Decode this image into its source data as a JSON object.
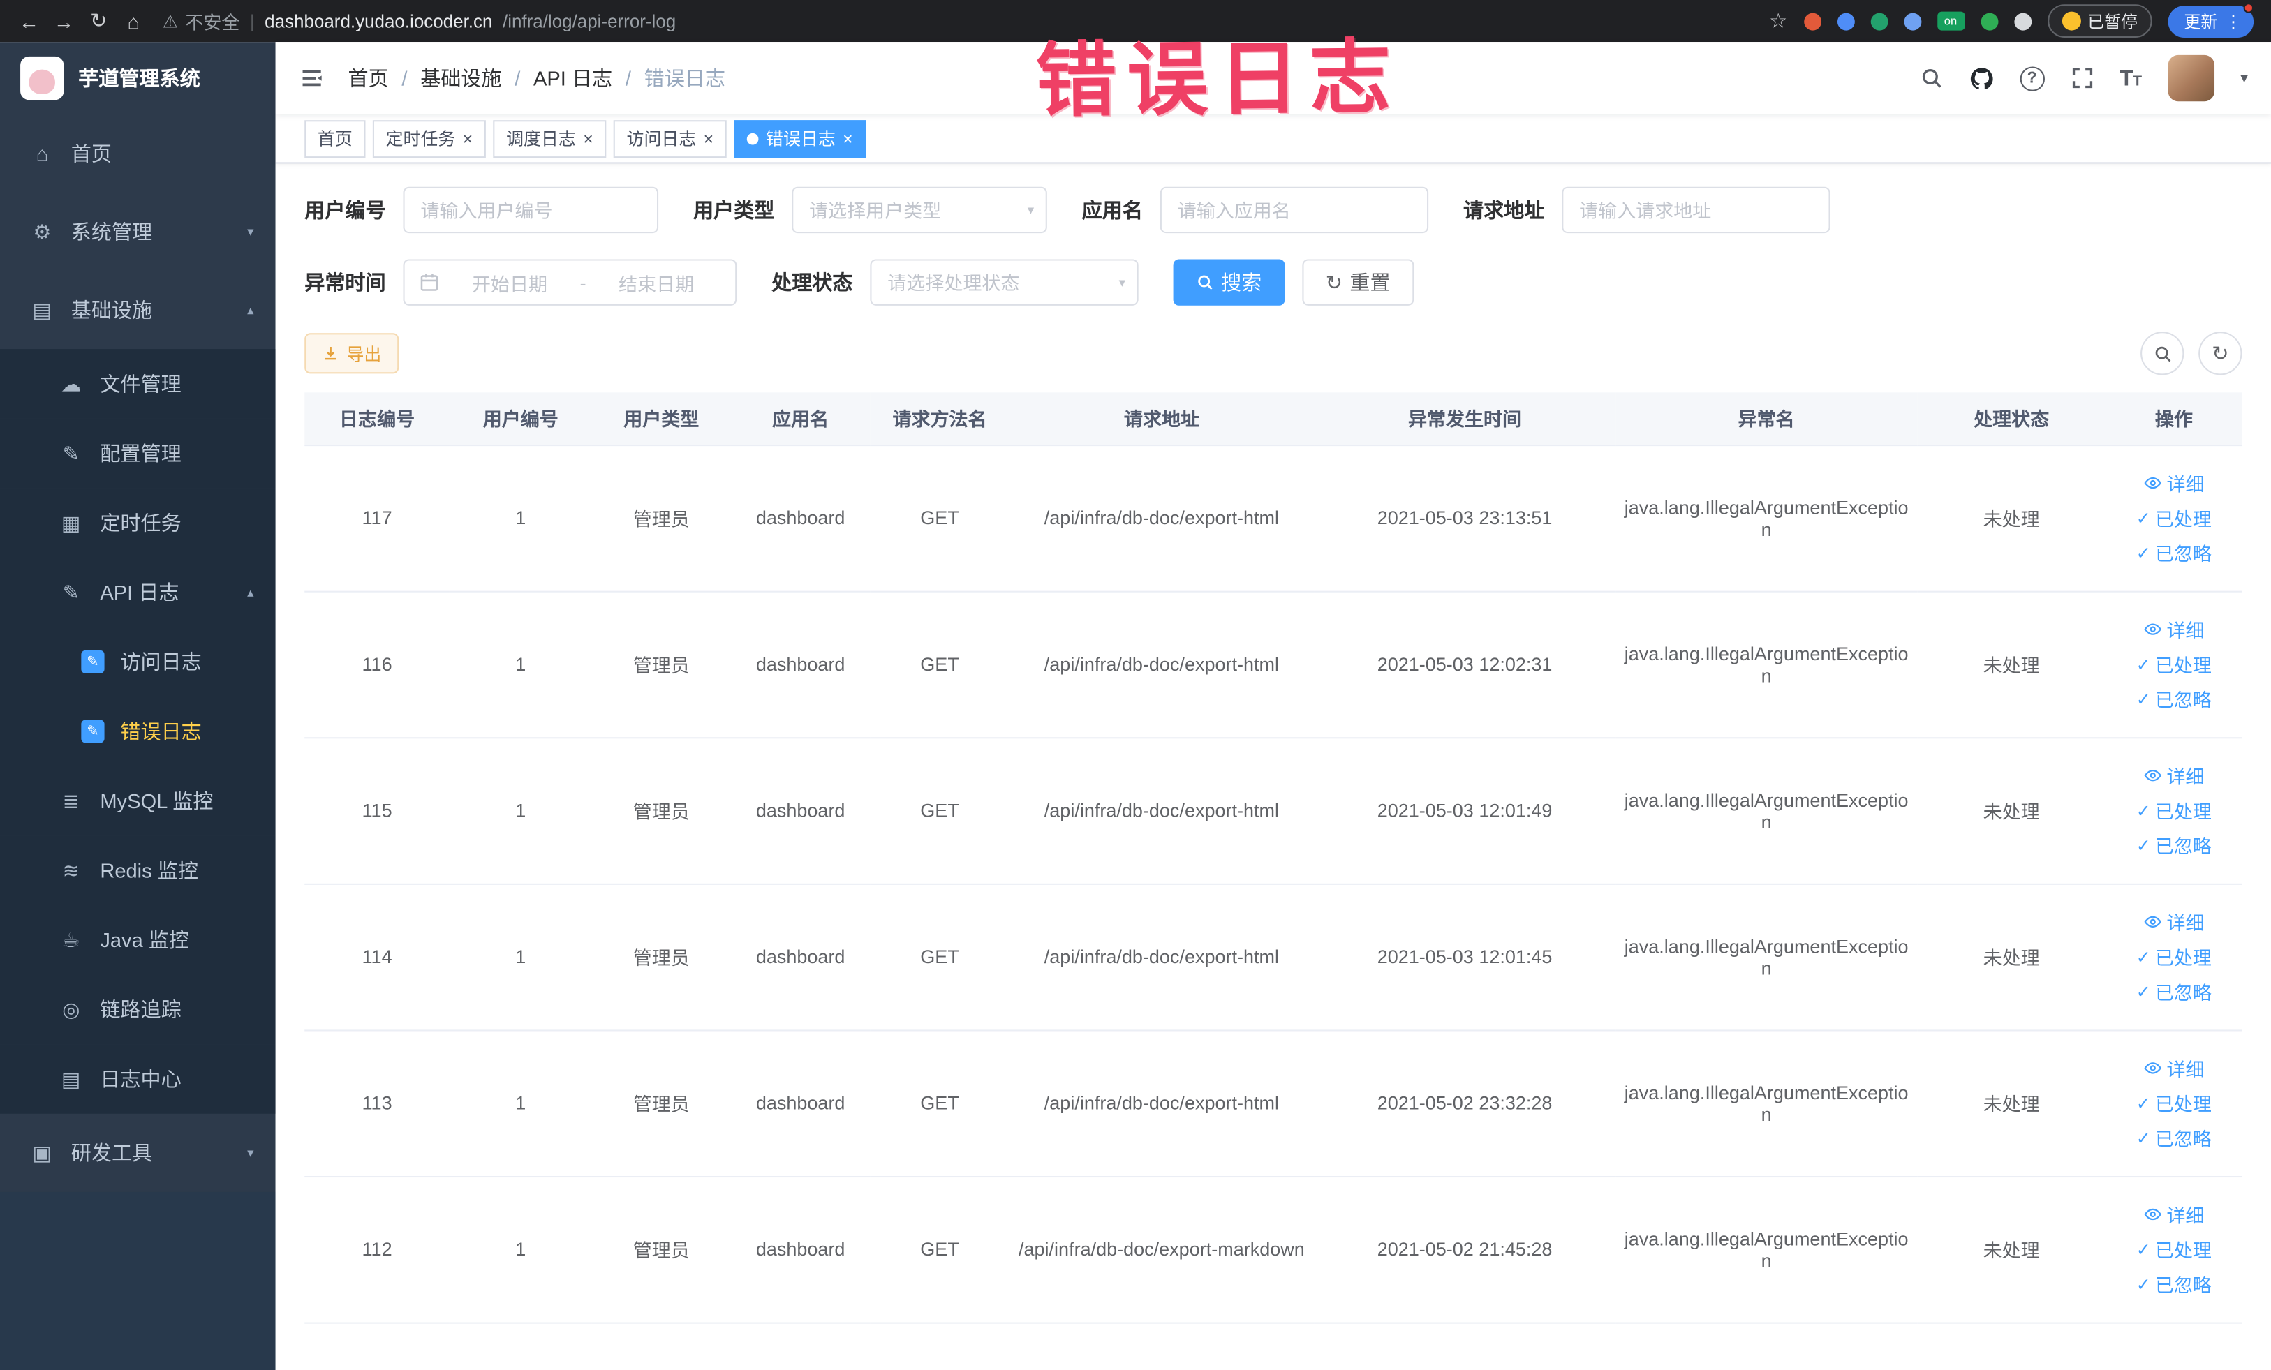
{
  "colors": {
    "accent": "#409eff",
    "active_menu_text": "#ffd04b",
    "warning": "#e6a23c",
    "annotation": "#ef4065",
    "sidebar_bg": "#2d3a4b",
    "submenu_bg": "#1f2d3d"
  },
  "icons": {
    "back": "←",
    "forward": "→",
    "reload": "↻",
    "home": "⌂",
    "warning": "⚠",
    "pipe": "|",
    "star": "☆",
    "kebab": "⋮",
    "caret_down": "▾",
    "caret_up": "▴",
    "close": "×",
    "check": "✓",
    "refresh": "↻",
    "help": "?",
    "font_large": "T",
    "font_small": "T",
    "menu_home": "⌂",
    "menu_system": "⚙",
    "menu_infra": "▤",
    "menu_file": "☁",
    "menu_config": "✎",
    "menu_job": "▦",
    "menu_api": "✎",
    "menu_edit": "✎",
    "menu_mysql": "≣",
    "menu_redis": "≋",
    "menu_java": "☕",
    "menu_trace": "◎",
    "menu_log": "▤",
    "menu_dev": "▣"
  },
  "annotation": {
    "text": "错误日志"
  },
  "browser": {
    "security_label": "不安全",
    "url_domain": "dashboard.yudao.iocoder.cn",
    "url_path": "/infra/log/api-error-log",
    "ext_on_label": "on",
    "paused_label": "已暂停",
    "update_label": "更新"
  },
  "sidebar": {
    "logo_title": "芋道管理系统",
    "items": {
      "home": "首页",
      "system": "系统管理",
      "infra": "基础设施",
      "file": "文件管理",
      "config": "配置管理",
      "job": "定时任务",
      "api_log": "API 日志",
      "access_log": "访问日志",
      "error_log": "错误日志",
      "mysql": "MySQL 监控",
      "redis": "Redis 监控",
      "java": "Java 监控",
      "trace": "链路追踪",
      "log_center": "日志中心",
      "dev_tools": "研发工具"
    }
  },
  "header": {
    "breadcrumb": [
      "首页",
      "基础设施",
      "API 日志",
      "错误日志"
    ],
    "separator": "/"
  },
  "tabs": [
    {
      "label": "首页"
    },
    {
      "label": "定时任务"
    },
    {
      "label": "调度日志"
    },
    {
      "label": "访问日志"
    },
    {
      "label": "错误日志"
    }
  ],
  "filters": {
    "user_id": {
      "label": "用户编号",
      "placeholder": "请输入用户编号"
    },
    "user_type": {
      "label": "用户类型",
      "placeholder": "请选择用户类型"
    },
    "app_name": {
      "label": "应用名",
      "placeholder": "请输入应用名"
    },
    "request_url": {
      "label": "请求地址",
      "placeholder": "请输入请求地址"
    },
    "exception_time": {
      "label": "异常时间",
      "start_placeholder": "开始日期",
      "separator": "-",
      "end_placeholder": "结束日期"
    },
    "process_status": {
      "label": "处理状态",
      "placeholder": "请选择处理状态"
    },
    "search_label": "搜索",
    "reset_label": "重置"
  },
  "toolbar": {
    "export_label": "导出"
  },
  "table": {
    "headers": [
      "日志编号",
      "用户编号",
      "用户类型",
      "应用名",
      "请求方法名",
      "请求地址",
      "异常发生时间",
      "异常名",
      "处理状态",
      "操作"
    ],
    "actions": [
      "详细",
      "已处理",
      "已忽略"
    ],
    "rows": [
      {
        "id": "117",
        "user_id": "1",
        "user_type": "管理员",
        "app": "dashboard",
        "method": "GET",
        "url": "/api/infra/db-doc/export-html",
        "time": "2021-05-03 23:13:51",
        "exception": "java.lang.IllegalArgumentException",
        "status": "未处理"
      },
      {
        "id": "116",
        "user_id": "1",
        "user_type": "管理员",
        "app": "dashboard",
        "method": "GET",
        "url": "/api/infra/db-doc/export-html",
        "time": "2021-05-03 12:02:31",
        "exception": "java.lang.IllegalArgumentException",
        "status": "未处理"
      },
      {
        "id": "115",
        "user_id": "1",
        "user_type": "管理员",
        "app": "dashboard",
        "method": "GET",
        "url": "/api/infra/db-doc/export-html",
        "time": "2021-05-03 12:01:49",
        "exception": "java.lang.IllegalArgumentException",
        "status": "未处理"
      },
      {
        "id": "114",
        "user_id": "1",
        "user_type": "管理员",
        "app": "dashboard",
        "method": "GET",
        "url": "/api/infra/db-doc/export-html",
        "time": "2021-05-03 12:01:45",
        "exception": "java.lang.IllegalArgumentException",
        "status": "未处理"
      },
      {
        "id": "113",
        "user_id": "1",
        "user_type": "管理员",
        "app": "dashboard",
        "method": "GET",
        "url": "/api/infra/db-doc/export-html",
        "time": "2021-05-02 23:32:28",
        "exception": "java.lang.IllegalArgumentException",
        "status": "未处理"
      },
      {
        "id": "112",
        "user_id": "1",
        "user_type": "管理员",
        "app": "dashboard",
        "method": "GET",
        "url": "/api/infra/db-doc/export-markdown",
        "time": "2021-05-02 21:45:28",
        "exception": "java.lang.IllegalArgumentException",
        "status": "未处理"
      }
    ]
  }
}
